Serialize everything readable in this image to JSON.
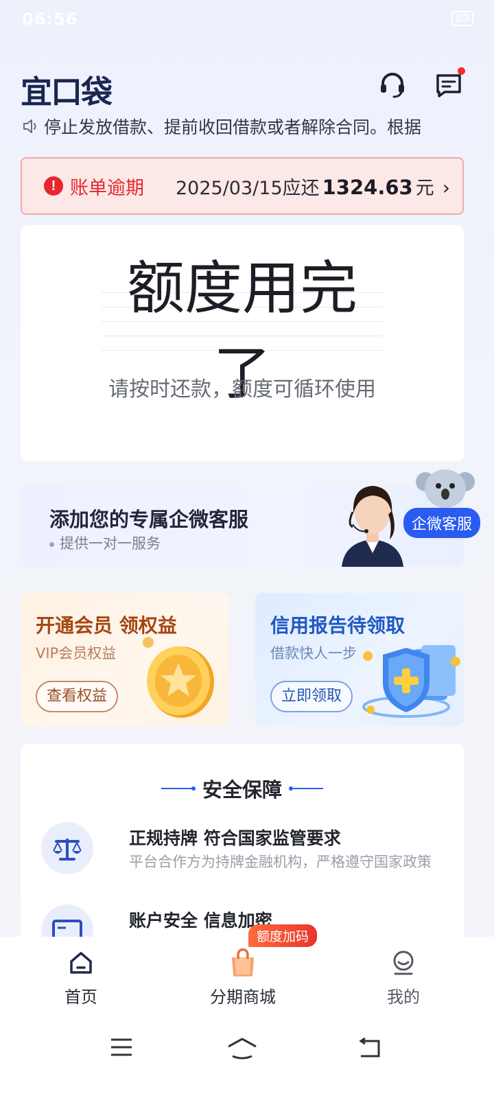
{
  "status_bar": {
    "time": "06:56",
    "icons": [
      "alarm-icon",
      "vibrate-icon",
      "hd-icon",
      "5g-signal-icon",
      "5g-signal-icon",
      "battery-icon"
    ],
    "battery_label": "89"
  },
  "header": {
    "logo": "宜口袋",
    "icons": [
      "headset-icon",
      "message-icon"
    ]
  },
  "notice": {
    "text": "停止发放借款、提前收回借款或者解除合同。根据"
  },
  "overdue": {
    "label": "账单逾期",
    "date_prefix": "2025/03/15应还",
    "amount": "1324.63",
    "unit": "元",
    "arrow": "›"
  },
  "credit": {
    "title": "额度用完了",
    "subtitle": "请按时还款，额度可循环使用"
  },
  "service": {
    "title": "添加您的专属企微客服",
    "subtitle": "提供一对一服务",
    "badge": "企微客服"
  },
  "promos": {
    "vip": {
      "title": "开通会员 领权益",
      "subtitle": "VIP会员权益",
      "button": "查看权益"
    },
    "report": {
      "title": "信用报告待领取",
      "subtitle": "借款快人一步",
      "button": "立即领取"
    }
  },
  "security": {
    "title": "安全保障",
    "items": [
      {
        "title": "正规持牌 符合国家监管要求",
        "desc": "平台合作方为持牌金融机构，严格遵守国家政策"
      },
      {
        "title": "账户安全 信息加密",
        "desc": ""
      }
    ]
  },
  "tabbar": {
    "tabs": [
      {
        "label": "首页",
        "icon": "home-icon"
      },
      {
        "label": "分期商城",
        "icon": "shopping-bag-icon"
      },
      {
        "label": "我的",
        "icon": "profile-icon"
      }
    ],
    "mall_badge": "额度加码"
  },
  "colors": {
    "primary": "#2b5cf2",
    "danger": "#e5262d",
    "brand_dark": "#1b2651"
  }
}
